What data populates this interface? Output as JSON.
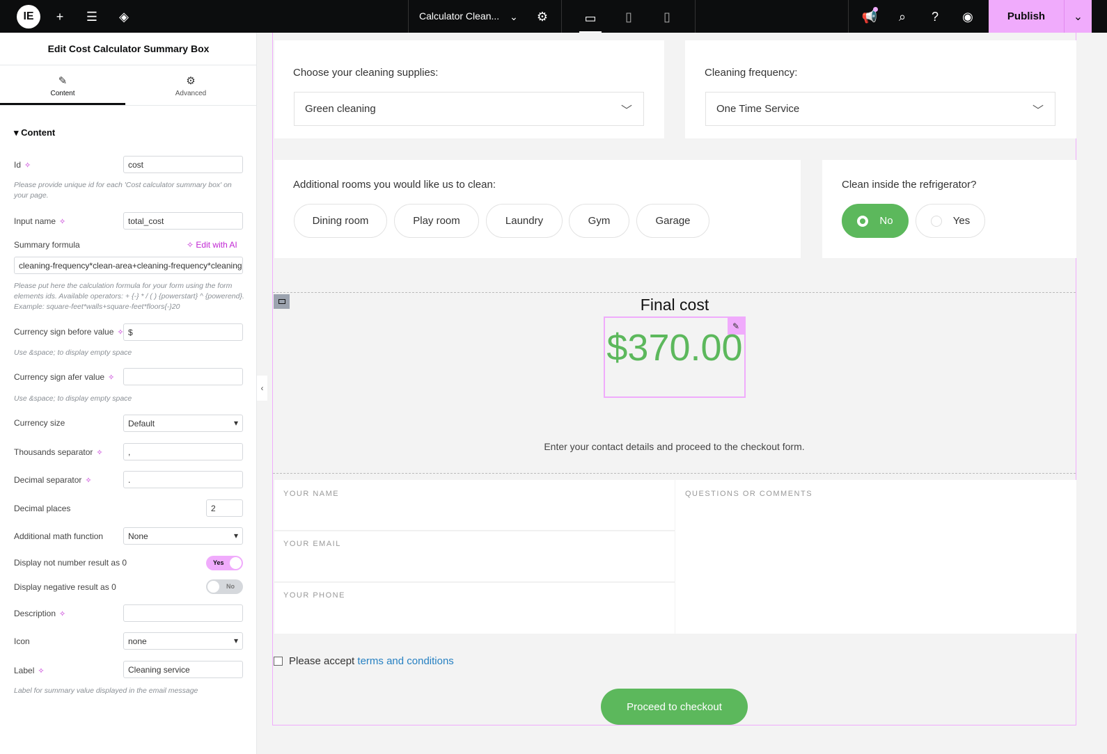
{
  "topbar": {
    "document_title": "Calculator Clean...",
    "publish_label": "Publish"
  },
  "panel": {
    "title": "Edit Cost Calculator Summary Box",
    "tabs": [
      {
        "label": "Content"
      },
      {
        "label": "Advanced"
      }
    ],
    "section": "Content",
    "fields": {
      "id": {
        "label": "Id",
        "value": "cost",
        "hint": "Please provide unique id for each 'Cost calculator summary box' on your page."
      },
      "input_name": {
        "label": "Input name",
        "value": "total_cost"
      },
      "summary_formula": {
        "label": "Summary formula",
        "ai_label": "Edit with AI",
        "value": "cleaning-frequency*clean-area+cleaning-frequency*cleaning",
        "hint": "Please put here the calculation formula for your form using the form elements ids. Available operators: + {-} * / ( ) {powerstart} ^ {powerend}. Example: square-feet*walls+square-feet*floors{-}20"
      },
      "currency_before": {
        "label": "Currency sign before value",
        "value": "$",
        "hint": "Use &space; to display empty space"
      },
      "currency_after": {
        "label": "Currency sign afer value",
        "value": "",
        "hint": "Use &space; to display empty space"
      },
      "currency_size": {
        "label": "Currency size",
        "value": "Default"
      },
      "thousands_separator": {
        "label": "Thousands separator",
        "value": ","
      },
      "decimal_separator": {
        "label": "Decimal separator",
        "value": "."
      },
      "decimal_places": {
        "label": "Decimal places",
        "value": "2"
      },
      "math_function": {
        "label": "Additional math function",
        "value": "None"
      },
      "not_number_zero": {
        "label": "Display not number result as 0",
        "state": "Yes"
      },
      "negative_zero": {
        "label": "Display negative result as 0",
        "state": "No"
      },
      "description": {
        "label": "Description",
        "value": ""
      },
      "icon": {
        "label": "Icon",
        "value": "none"
      },
      "label": {
        "label": "Label",
        "value": "Cleaning service",
        "hint": "Label for summary value displayed in the email message"
      }
    }
  },
  "page": {
    "supplies": {
      "label": "Choose your cleaning supplies:",
      "value": "Green cleaning"
    },
    "frequency": {
      "label": "Cleaning frequency:",
      "value": "One Time Service"
    },
    "rooms": {
      "label": "Additional rooms you would like us to clean:",
      "options": [
        "Dining room",
        "Play room",
        "Laundry",
        "Gym",
        "Garage"
      ]
    },
    "fridge": {
      "label": "Clean inside the refrigerator?",
      "options": [
        "No",
        "Yes"
      ],
      "selected": "No"
    },
    "final_cost_title": "Final cost",
    "final_cost_value": "$370.00",
    "contact_text": "Enter your contact details and proceed to the checkout form.",
    "form": {
      "name": "YOUR NAME",
      "email": "YOUR EMAIL",
      "phone": "YOUR PHONE",
      "comments": "QUESTIONS OR COMMENTS"
    },
    "terms_prefix": "Please accept ",
    "terms_link": "terms and conditions",
    "checkout": "Proceed to checkout"
  },
  "colors": {
    "accent": "#f0abfc",
    "green": "#5cb85c",
    "ai": "#c026d3"
  }
}
